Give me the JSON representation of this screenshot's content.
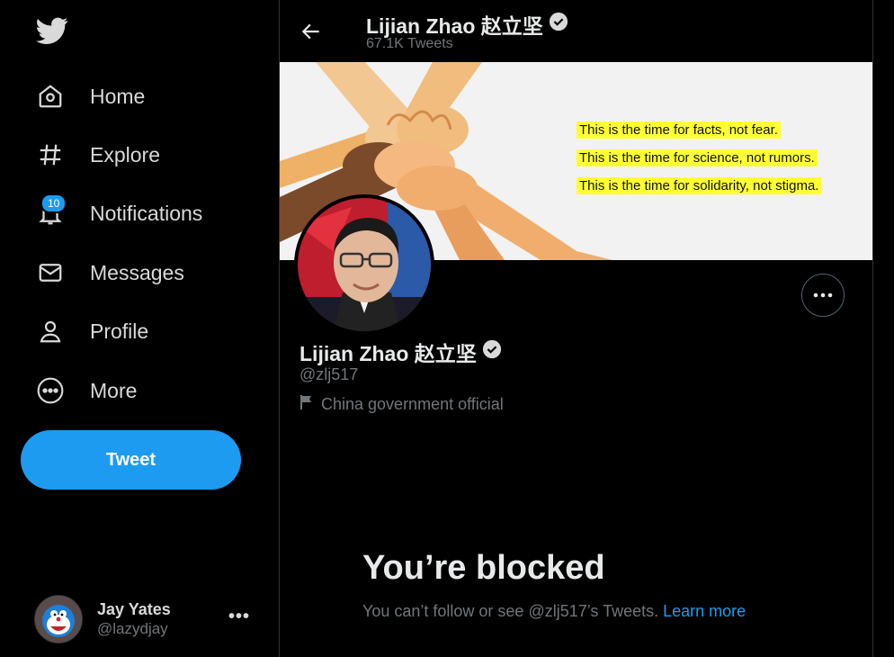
{
  "sidebar": {
    "logo_icon": "twitter-bird-icon",
    "items": [
      {
        "label": "Home",
        "icon": "home-icon"
      },
      {
        "label": "Explore",
        "icon": "hashtag-icon"
      },
      {
        "label": "Notifications",
        "icon": "bell-icon",
        "badge": "10"
      },
      {
        "label": "Messages",
        "icon": "envelope-icon"
      },
      {
        "label": "Profile",
        "icon": "person-icon"
      },
      {
        "label": "More",
        "icon": "more-circle-icon"
      }
    ],
    "tweet_button": "Tweet",
    "account": {
      "name": "Jay Yates",
      "handle": "@lazydjay",
      "more": "•••"
    }
  },
  "header": {
    "title": "Lijian Zhao 赵立坚",
    "subtitle": "67.1K Tweets"
  },
  "banner": {
    "lines": [
      "This is the time for facts, not fear.",
      "This is the time for science, not rumors.",
      "This is the time for solidarity, not stigma."
    ],
    "highlight_color": "#ffff33"
  },
  "profile": {
    "name": "Lijian Zhao 赵立坚",
    "handle": "@zlj517",
    "label": "China government official"
  },
  "blocked": {
    "title": "You’re blocked",
    "message": "You can’t follow or see @zlj517’s Tweets.",
    "link": "Learn more"
  },
  "colors": {
    "accent": "#1d9bf0",
    "background": "#000000",
    "muted": "#71767b"
  }
}
